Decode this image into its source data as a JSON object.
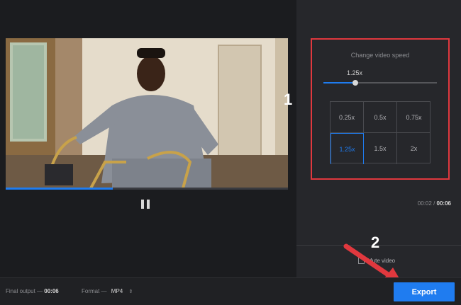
{
  "player": {
    "current_time": "00:02",
    "separator": "/",
    "total_time": "00:06",
    "progress_fraction": 0.38
  },
  "speed_panel": {
    "title": "Change video speed",
    "current_value": "1.25x",
    "slider_fraction": 0.28,
    "options": [
      "0.25x",
      "0.5x",
      "0.75x",
      "1.25x",
      "1.5x",
      "2x"
    ],
    "selected": "1.25x"
  },
  "mute": {
    "label": "Mute video"
  },
  "annotations": {
    "step1": "1",
    "step2": "2",
    "highlight_color": "#e0383e"
  },
  "footer": {
    "final_output_label": "Final output —",
    "final_output_value": "00:06",
    "format_label": "Format —",
    "format_value": "MP4",
    "export_label": "Export"
  },
  "colors": {
    "accent": "#1f7cf0",
    "background": "#1b1c1f",
    "panel": "#26272b"
  },
  "icons": {
    "pause": "pause-icon",
    "format_toggle": "chevron-updown-icon"
  }
}
